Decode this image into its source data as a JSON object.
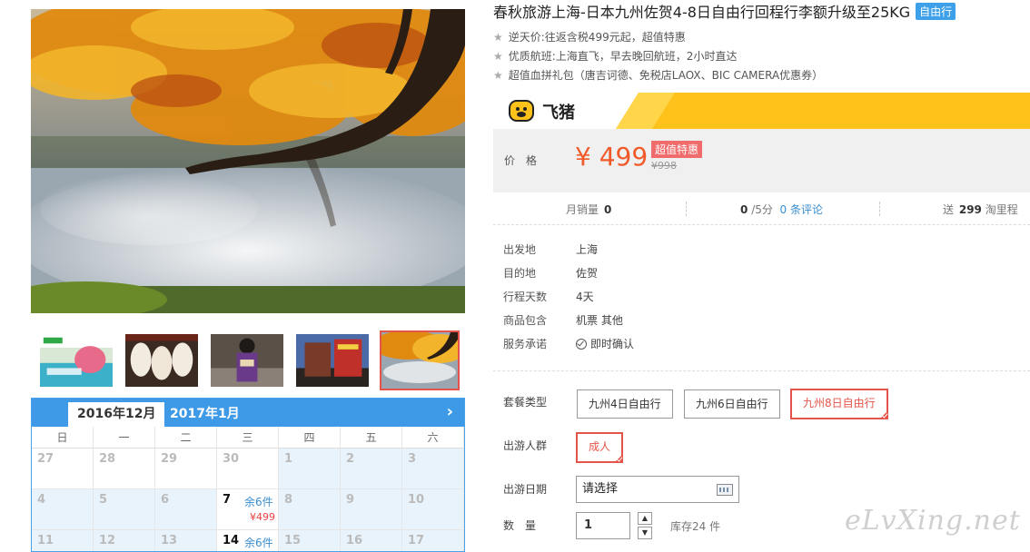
{
  "product": {
    "title": "春秋旅游上海-日本九州佐贺4-8日自由行回程行李额升级至25KG",
    "type_badge": "自由行",
    "features": [
      "逆天价:往返含税499元起，超值特惠",
      "优质航班:上海直飞，早去晚回航班，2小时直达",
      "超值血拼礼包（唐吉诃德、免税店LAOX、BIC CAMERA优惠券）"
    ]
  },
  "brand": {
    "name": "飞猪",
    "accent": "#ffc21a"
  },
  "pricing": {
    "label": "价格",
    "currency": "¥",
    "price": "499",
    "tag": "超值特惠",
    "original": "¥998",
    "price_color": "#f05a2a"
  },
  "stats": {
    "monthly_label": "月销量",
    "monthly_value": "0",
    "rating_value": "0",
    "rating_suffix": "/5分",
    "reviews_link": "0 条评论",
    "gift_prefix": "送",
    "gift_value": "299",
    "gift_suffix": "淘里程"
  },
  "props": [
    {
      "key": "出发地",
      "value": "上海"
    },
    {
      "key": "目的地",
      "value": "佐贺"
    },
    {
      "key": "行程天数",
      "value": "4天"
    },
    {
      "key": "商品包含",
      "value": "机票  其他"
    },
    {
      "key": "服务承诺",
      "value": "即时确认"
    }
  ],
  "options": {
    "package_label": "套餐类型",
    "packages": [
      "九州4日自由行",
      "九州6日自由行",
      "九州8日自由行"
    ],
    "selected_package": 2,
    "traveler_label": "出游人群",
    "traveler": "成人",
    "date_label": "出游日期",
    "date_placeholder": "请选择",
    "qty_label": "数量",
    "qty_value": "1",
    "stock_text": "库存24 件"
  },
  "calendar": {
    "month_active": "2016年12月",
    "month_next": "2017年1月",
    "next_icon": "chevron-right-icon",
    "weekdays": [
      "日",
      "一",
      "二",
      "三",
      "四",
      "五",
      "六"
    ],
    "rows": [
      [
        {
          "d": "27"
        },
        {
          "d": "28"
        },
        {
          "d": "29"
        },
        {
          "d": "30"
        },
        {
          "d": "1",
          "blue": true
        },
        {
          "d": "2",
          "blue": true
        },
        {
          "d": "3",
          "blue": true
        }
      ],
      [
        {
          "d": "4",
          "blue": true
        },
        {
          "d": "5",
          "blue": true
        },
        {
          "d": "6",
          "blue": true
        },
        {
          "d": "7",
          "avail": true,
          "stock": "余6件",
          "price": "¥499"
        },
        {
          "d": "8",
          "blue": true
        },
        {
          "d": "9",
          "blue": true
        },
        {
          "d": "10",
          "blue": true
        }
      ],
      [
        {
          "d": "11",
          "blue": true
        },
        {
          "d": "12",
          "blue": true
        },
        {
          "d": "13",
          "blue": true
        },
        {
          "d": "14",
          "avail": true,
          "stock": "余6件"
        },
        {
          "d": "15",
          "blue": true
        },
        {
          "d": "16",
          "blue": true
        },
        {
          "d": "17",
          "blue": true
        }
      ]
    ]
  },
  "watermark": "eLvXing.net"
}
